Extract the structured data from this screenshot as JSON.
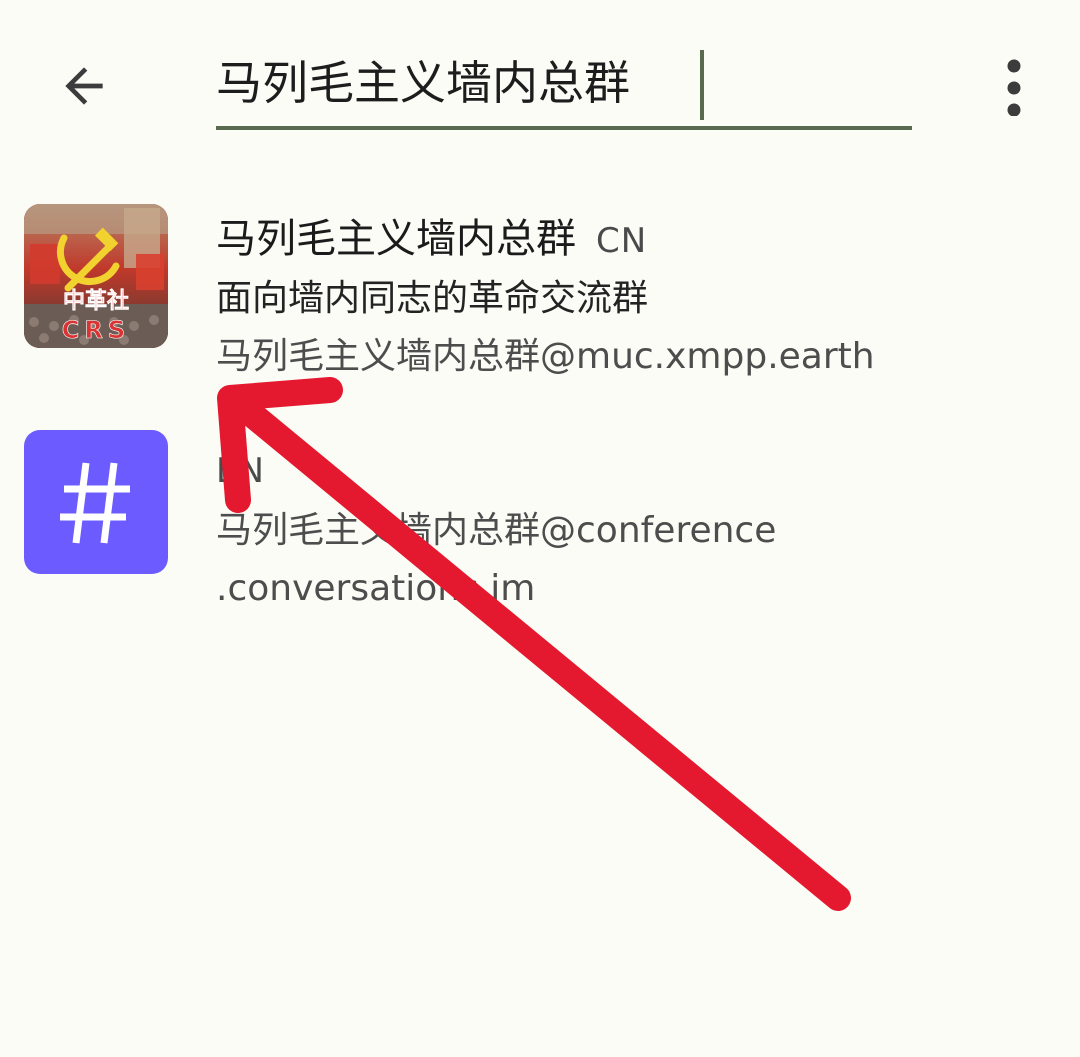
{
  "search": {
    "query": "马列毛主义墙内总群",
    "back_icon": "arrow-back-icon",
    "menu_icon": "more-vert-icon"
  },
  "results": [
    {
      "name": "马列毛主义墙内总群",
      "language": "CN",
      "description": "面向墙内同志的革命交流群",
      "address": "马列毛主义墙内总群@muc.xmpp.earth",
      "avatar_text": [
        "中革社",
        "CRS"
      ]
    },
    {
      "name": "",
      "language": "EN",
      "description": "",
      "address_line1": "马列毛主义墙内总群@conference",
      "address_line2": ".conversations.im",
      "avatar_icon": "#"
    }
  ],
  "colors": {
    "background": "#fbfcf6",
    "underline": "#5a6a4f",
    "hash_avatar": "#6c5cff",
    "annotation_arrow": "#e4192f"
  }
}
